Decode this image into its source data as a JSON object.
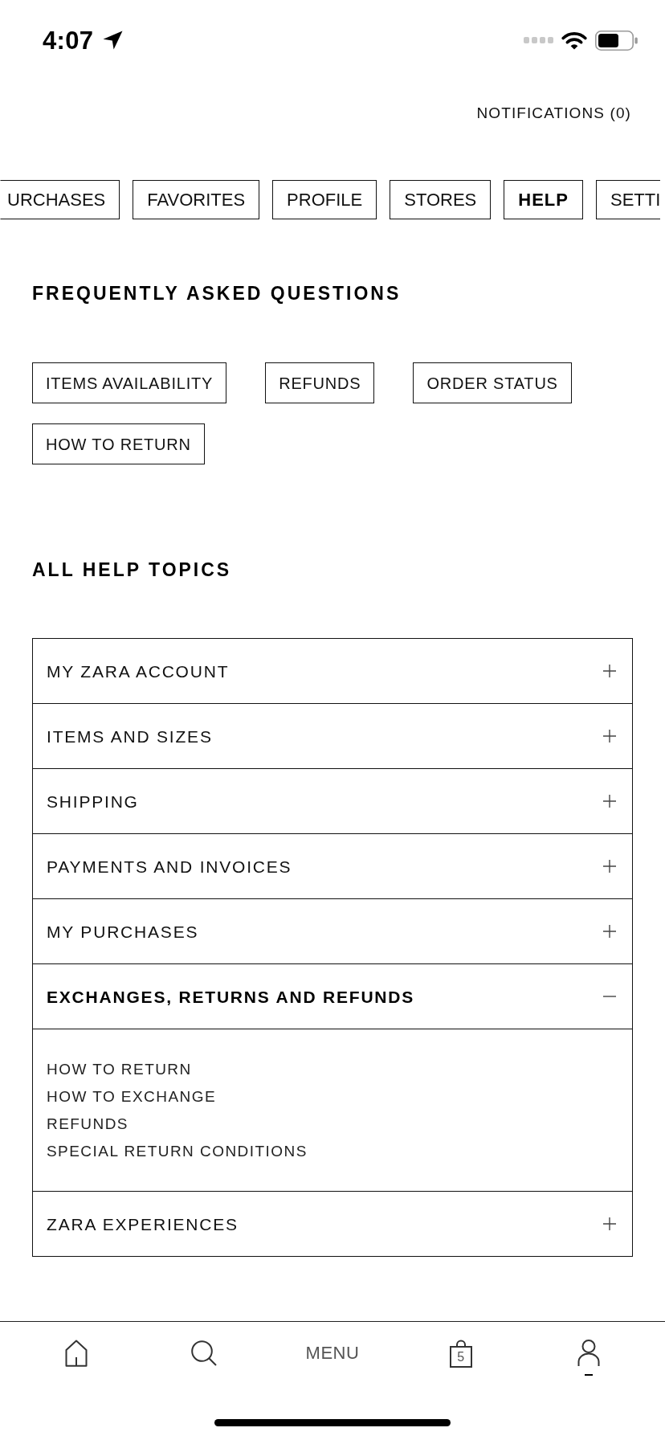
{
  "status_bar": {
    "time": "4:07"
  },
  "notifications": {
    "label": "NOTIFICATIONS (0)"
  },
  "tabs": [
    {
      "label": "URCHASES",
      "selected": false
    },
    {
      "label": "FAVORITES",
      "selected": false
    },
    {
      "label": "PROFILE",
      "selected": false
    },
    {
      "label": "STORES",
      "selected": false
    },
    {
      "label": "HELP",
      "selected": true
    },
    {
      "label": "SETTI",
      "selected": false
    }
  ],
  "faq": {
    "title": "FREQUENTLY ASKED QUESTIONS",
    "topics": [
      "ITEMS AVAILABILITY",
      "REFUNDS",
      "ORDER STATUS",
      "HOW TO RETURN"
    ]
  },
  "help_topics": {
    "title": "ALL HELP TOPICS",
    "items": [
      {
        "label": "MY ZARA ACCOUNT",
        "expanded": false
      },
      {
        "label": "ITEMS AND SIZES",
        "expanded": false
      },
      {
        "label": "SHIPPING",
        "expanded": false
      },
      {
        "label": "PAYMENTS AND INVOICES",
        "expanded": false
      },
      {
        "label": "MY PURCHASES",
        "expanded": false
      },
      {
        "label": "EXCHANGES, RETURNS AND REFUNDS",
        "expanded": true,
        "links": [
          "HOW TO RETURN",
          "HOW TO EXCHANGE",
          "REFUNDS",
          "SPECIAL RETURN CONDITIONS"
        ]
      },
      {
        "label": "ZARA EXPERIENCES",
        "expanded": false
      }
    ]
  },
  "bottom_nav": [
    {
      "kind": "home",
      "selected": false
    },
    {
      "kind": "search",
      "selected": false
    },
    {
      "kind": "menu",
      "label": "MENU",
      "selected": false
    },
    {
      "kind": "bag",
      "count": "5",
      "selected": false
    },
    {
      "kind": "account",
      "selected": true
    }
  ]
}
